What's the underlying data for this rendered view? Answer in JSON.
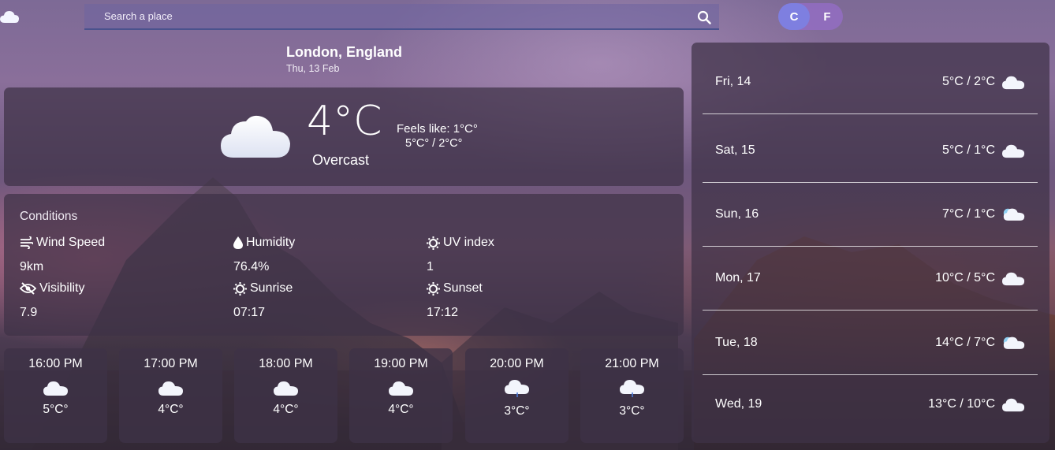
{
  "search": {
    "placeholder": "Search a place"
  },
  "units": {
    "celsius": "C",
    "fahrenheit": "F",
    "selected": "C"
  },
  "location": {
    "city": "London,",
    "region": "England",
    "date": "Thu, 13 Feb"
  },
  "current": {
    "temperature": "4°C",
    "description": "Overcast",
    "feels_like": "Feels like: 1°C°",
    "high": "5°C°",
    "separator": "/",
    "low": "2°C°",
    "icon": "cloud-icon"
  },
  "conditions": {
    "title": "Conditions",
    "items": [
      {
        "label": "Wind Speed",
        "value": "9km",
        "icon": "wind-icon"
      },
      {
        "label": "Humidity",
        "value": "76.4%",
        "icon": "droplet-icon"
      },
      {
        "label": "UV index",
        "value": "1",
        "icon": "sun-icon"
      },
      {
        "label": "Visibility",
        "value": "7.9",
        "icon": "eye-slash-icon"
      },
      {
        "label": "Sunrise",
        "value": "07:17",
        "icon": "sun-icon"
      },
      {
        "label": "Sunset",
        "value": "17:12",
        "icon": "sun-icon"
      }
    ]
  },
  "hourly": [
    {
      "time": "16:00 PM",
      "temp": "5°C°",
      "icon": "cloud-icon"
    },
    {
      "time": "17:00 PM",
      "temp": "4°C°",
      "icon": "cloud-icon"
    },
    {
      "time": "18:00 PM",
      "temp": "4°C°",
      "icon": "cloud-icon"
    },
    {
      "time": "19:00 PM",
      "temp": "4°C°",
      "icon": "cloud-icon"
    },
    {
      "time": "20:00 PM",
      "temp": "3°C°",
      "icon": "rain-cloud-icon"
    },
    {
      "time": "21:00 PM",
      "temp": "3°C°",
      "icon": "rain-cloud-icon"
    }
  ],
  "forecast": [
    {
      "day": "Fri, 14",
      "temps": "5°C / 2°C",
      "icon": "cloud-icon"
    },
    {
      "day": "Sat, 15",
      "temps": "5°C / 1°C",
      "icon": "cloud-icon"
    },
    {
      "day": "Sun, 16",
      "temps": "7°C / 1°C",
      "icon": "partly-cloudy-icon"
    },
    {
      "day": "Mon, 17",
      "temps": "10°C / 5°C",
      "icon": "cloud-icon"
    },
    {
      "day": "Tue, 18",
      "temps": "14°C / 7°C",
      "icon": "partly-cloudy-icon"
    },
    {
      "day": "Wed, 19",
      "temps": "13°C / 10°C",
      "icon": "cloud-icon"
    }
  ],
  "colors": {
    "accent": "#7e7fe0",
    "toggle_bg": "#9a6ec8",
    "panel": "#3e3246"
  }
}
